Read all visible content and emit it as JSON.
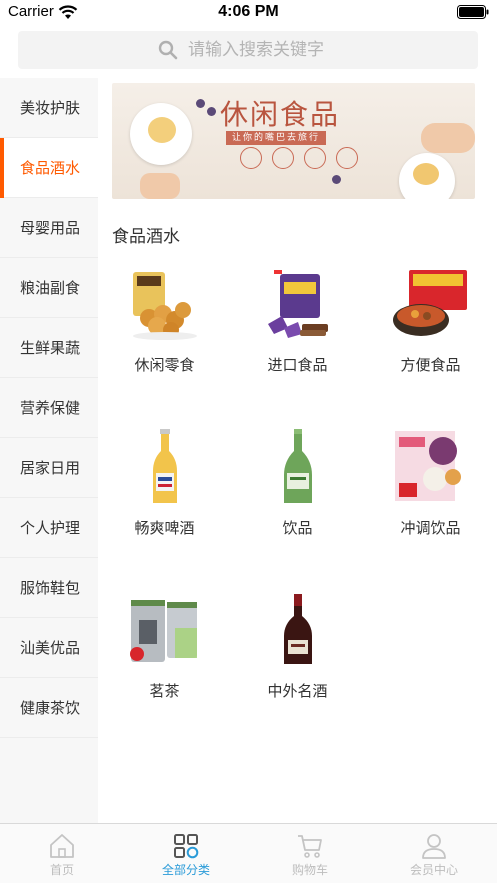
{
  "status_bar": {
    "carrier": "Carrier",
    "time": "4:06 PM"
  },
  "search": {
    "placeholder": "请输入搜索关键字"
  },
  "sidebar": {
    "active_index": 1,
    "items": [
      {
        "label": "美妆护肤"
      },
      {
        "label": "食品酒水"
      },
      {
        "label": "母婴用品"
      },
      {
        "label": "粮油副食"
      },
      {
        "label": "生鲜果蔬"
      },
      {
        "label": "营养保健"
      },
      {
        "label": "居家日用"
      },
      {
        "label": "个人护理"
      },
      {
        "label": "服饰鞋包"
      },
      {
        "label": "汕美优品"
      },
      {
        "label": "健康茶饮"
      }
    ]
  },
  "banner": {
    "title": "休闲食品",
    "slogan": "让你的嘴巴去旅行"
  },
  "section": {
    "title": "食品酒水"
  },
  "categories": [
    {
      "label": "休闲零食",
      "icon": "snack-image"
    },
    {
      "label": "进口食品",
      "icon": "imported-chocolate-image"
    },
    {
      "label": "方便食品",
      "icon": "instant-noodle-image"
    },
    {
      "label": "畅爽啤酒",
      "icon": "beer-bottle-image"
    },
    {
      "label": "饮品",
      "icon": "sparkling-water-image"
    },
    {
      "label": "冲调饮品",
      "icon": "drink-mix-image"
    },
    {
      "label": "茗茶",
      "icon": "tea-tin-image"
    },
    {
      "label": "中外名酒",
      "icon": "cognac-bottle-image"
    }
  ],
  "tabbar": {
    "active_index": 1,
    "accent_color": "#2a9bd8",
    "tabs": [
      {
        "label": "首页",
        "icon": "home-icon"
      },
      {
        "label": "全部分类",
        "icon": "category-grid-icon"
      },
      {
        "label": "购物车",
        "icon": "cart-icon"
      },
      {
        "label": "会员中心",
        "icon": "user-icon"
      }
    ]
  },
  "colors": {
    "active_category": "#ff5a00",
    "sidebar_bg": "#f7f7f7"
  }
}
